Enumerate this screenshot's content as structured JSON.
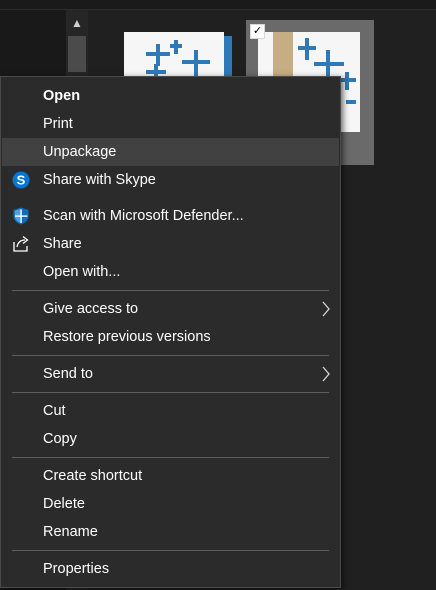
{
  "menu": {
    "items": [
      {
        "label": "Open"
      },
      {
        "label": "Print"
      },
      {
        "label": "Unpackage"
      },
      {
        "label": "Share with Skype"
      },
      {
        "label": "Scan with Microsoft Defender..."
      },
      {
        "label": "Share"
      },
      {
        "label": "Open with..."
      },
      {
        "label": "Give access to"
      },
      {
        "label": "Restore previous versions"
      },
      {
        "label": "Send to"
      },
      {
        "label": "Cut"
      },
      {
        "label": "Copy"
      },
      {
        "label": "Create shortcut"
      },
      {
        "label": "Delete"
      },
      {
        "label": "Rename"
      },
      {
        "label": "Properties"
      }
    ],
    "highlighted": "Unpackage",
    "colors": {
      "background": "#2b2b2b",
      "highlight": "#414141",
      "text": "#ffffff",
      "skype": "#0078d4",
      "defender": "#0f6cbd"
    }
  },
  "thumbnails": {
    "icon": "tableau-logo-icon",
    "accent": "#2e7ab8",
    "checkbox": "checked"
  }
}
